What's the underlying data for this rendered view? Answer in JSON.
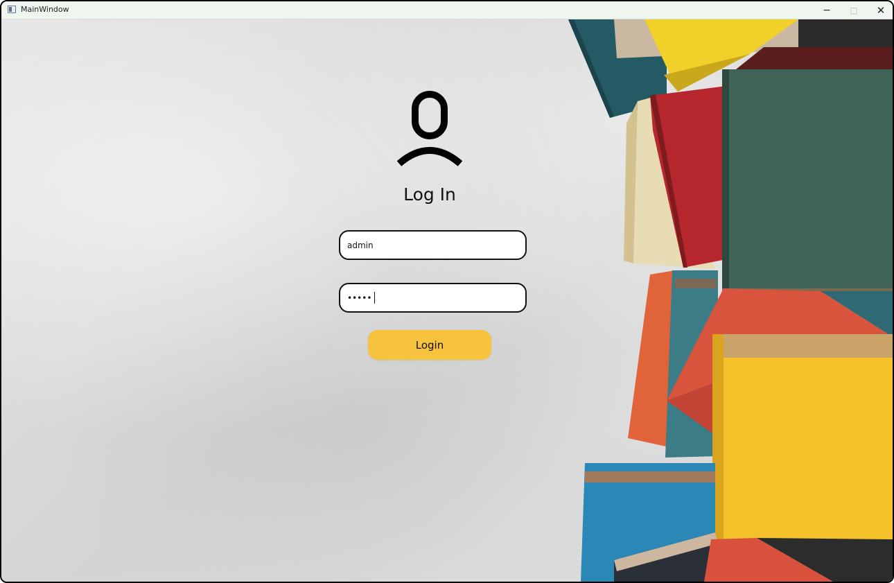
{
  "window": {
    "title": "MainWindow",
    "controls": {
      "minimize": "−",
      "maximize": "□",
      "close": "✕"
    }
  },
  "login": {
    "heading": "Log In",
    "username": {
      "value": "admin"
    },
    "password": {
      "value": "12345"
    },
    "button_label": "Login"
  },
  "icons": {
    "app": "window-app-icon",
    "user": "user-icon"
  },
  "colors": {
    "accent": "#f7c23d",
    "field_border": "#111111",
    "background": "#d9d9d9"
  }
}
